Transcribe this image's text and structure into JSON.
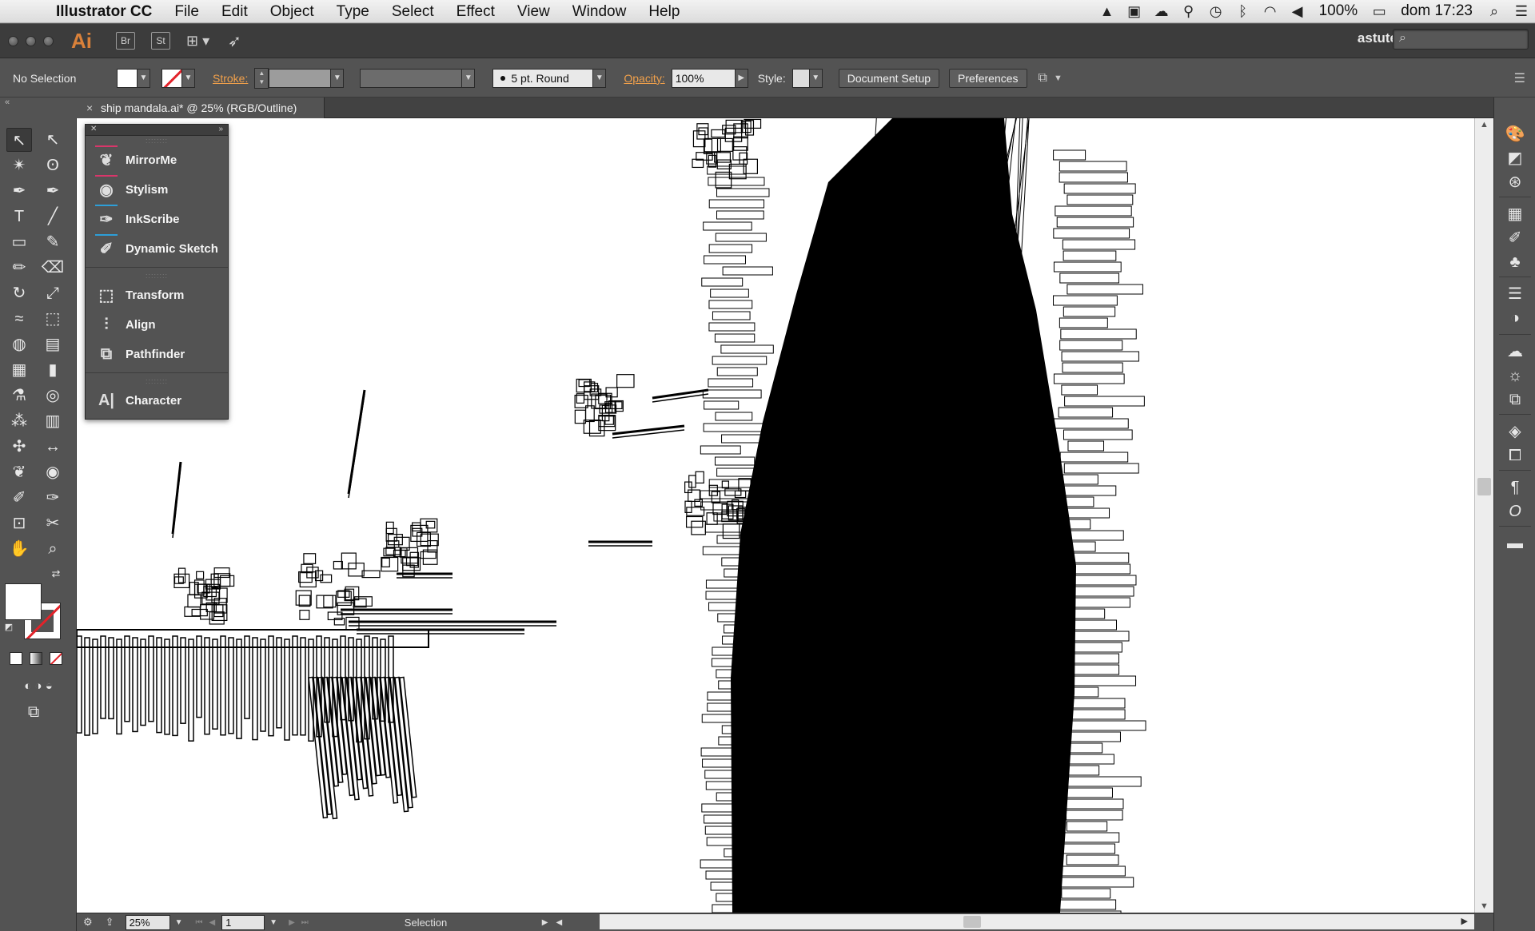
{
  "menubar": {
    "apple_glyph": "",
    "app_name": "Illustrator CC",
    "items": [
      "File",
      "Edit",
      "Object",
      "Type",
      "Select",
      "Effect",
      "View",
      "Window",
      "Help"
    ],
    "battery": "100%",
    "clock": "dom 17:23"
  },
  "appbar": {
    "logo": "Ai",
    "bridge_label": "Br",
    "stock_label": "St",
    "workspace": "astute"
  },
  "controlbar": {
    "selection": "No Selection",
    "stroke_label": "Stroke:",
    "brush": "5 pt. Round",
    "opacity_label": "Opacity:",
    "opacity_value": "100%",
    "style_label": "Style:",
    "document_setup": "Document Setup",
    "preferences": "Preferences"
  },
  "document": {
    "tab_title": "ship mandala.ai* @ 25% (RGB/Outline)"
  },
  "floating_panel": {
    "groups": [
      [
        {
          "name": "MirrorMe",
          "icon": "butterfly-icon",
          "accent": "#d9366a"
        },
        {
          "name": "Stylism",
          "icon": "stylism-icon",
          "accent": "#d9366a"
        },
        {
          "name": "InkScribe",
          "icon": "pen-nib-icon",
          "accent": "#2d9fd8"
        },
        {
          "name": "Dynamic Sketch",
          "icon": "sketch-icon",
          "accent": "#2d9fd8"
        }
      ],
      [
        {
          "name": "Transform",
          "icon": "transform-icon"
        },
        {
          "name": "Align",
          "icon": "align-icon"
        },
        {
          "name": "Pathfinder",
          "icon": "pathfinder-icon"
        }
      ],
      [
        {
          "name": "Character",
          "icon": "character-icon"
        }
      ]
    ]
  },
  "statusbar": {
    "zoom": "25%",
    "artboard": "1",
    "tool_name": "Selection"
  },
  "colors": {
    "panel_bg": "#535353",
    "canvas_bg": "#ffffff",
    "accent_orange": "#f0a04b",
    "stroke_none_red": "#e2232a",
    "logo_orange": "#d9813a"
  }
}
